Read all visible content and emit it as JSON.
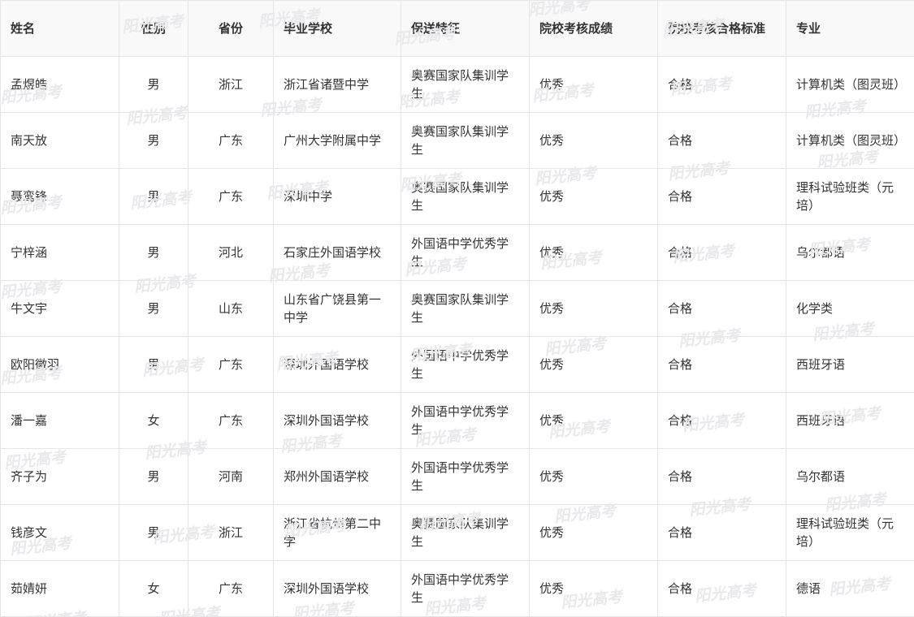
{
  "watermark": "阳光高考",
  "table": {
    "headers": [
      {
        "key": "name",
        "label": "姓名"
      },
      {
        "key": "gender",
        "label": "性别"
      },
      {
        "key": "province",
        "label": "省份"
      },
      {
        "key": "school",
        "label": "毕业学校"
      },
      {
        "key": "feature",
        "label": "保送特征"
      },
      {
        "key": "result",
        "label": "院校考核成绩"
      },
      {
        "key": "standard",
        "label": "院校考核合格标准"
      },
      {
        "key": "major",
        "label": "专业"
      }
    ],
    "rows": [
      {
        "name": "孟煜皓",
        "gender": "男",
        "province": "浙江",
        "school": "浙江省诸暨中学",
        "feature": "奥赛国家队集训学生",
        "result": "优秀",
        "standard": "合格",
        "major": "计算机类（图灵班）"
      },
      {
        "name": "南天放",
        "gender": "男",
        "province": "广东",
        "school": "广州大学附属中学",
        "feature": "奥赛国家队集训学生",
        "result": "优秀",
        "standard": "合格",
        "major": "计算机类（图灵班）"
      },
      {
        "name": "聂鸾锋",
        "gender": "男",
        "province": "广东",
        "school": "深圳中学",
        "feature": "奥赛国家队集训学生",
        "result": "优秀",
        "standard": "合格",
        "major": "理科试验班类（元培）"
      },
      {
        "name": "宁梓涵",
        "gender": "男",
        "province": "河北",
        "school": "石家庄外国语学校",
        "feature": "外国语中学优秀学生",
        "result": "优秀",
        "standard": "合格",
        "major": "乌尔都语"
      },
      {
        "name": "牛文宇",
        "gender": "男",
        "province": "山东",
        "school": "山东省广饶县第一中学",
        "feature": "奥赛国家队集训学生",
        "result": "优秀",
        "standard": "合格",
        "major": "化学类"
      },
      {
        "name": "欧阳徵羽",
        "gender": "男",
        "province": "广东",
        "school": "深圳外国语学校",
        "feature": "外国语中学优秀学生",
        "result": "优秀",
        "standard": "合格",
        "major": "西班牙语"
      },
      {
        "name": "潘一嘉",
        "gender": "女",
        "province": "广东",
        "school": "深圳外国语学校",
        "feature": "外国语中学优秀学生",
        "result": "优秀",
        "standard": "合格",
        "major": "西班牙语"
      },
      {
        "name": "齐子为",
        "gender": "男",
        "province": "河南",
        "school": "郑州外国语学校",
        "feature": "外国语中学优秀学生",
        "result": "优秀",
        "standard": "合格",
        "major": "乌尔都语"
      },
      {
        "name": "钱彦文",
        "gender": "男",
        "province": "浙江",
        "school": "浙江省杭州第二中学",
        "feature": "奥赛国家队集训学生",
        "result": "优秀",
        "standard": "合格",
        "major": "理科试验班类（元培）"
      },
      {
        "name": "茹婧妍",
        "gender": "女",
        "province": "广东",
        "school": "深圳外国语学校",
        "feature": "外国语中学优秀学生",
        "result": "优秀",
        "standard": "合格",
        "major": "德语"
      }
    ]
  }
}
